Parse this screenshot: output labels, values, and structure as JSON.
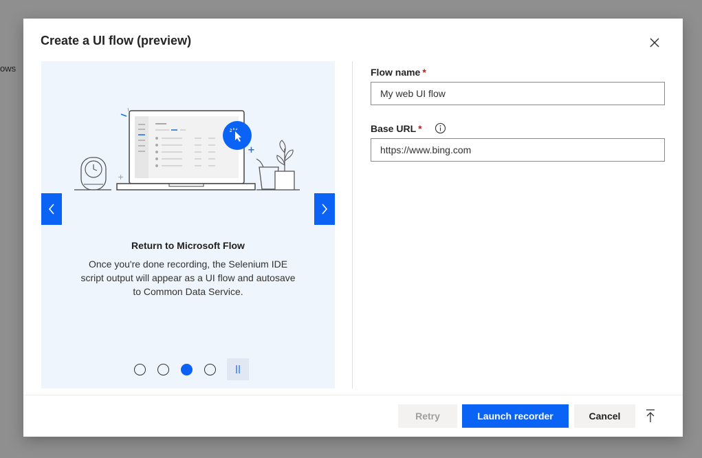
{
  "background": {
    "partial_text": "ows"
  },
  "dialog": {
    "title": "Create a UI flow (preview)",
    "close_icon": "close-icon"
  },
  "carousel": {
    "slide_title": "Return to Microsoft Flow",
    "slide_description": "Once you're done recording, the Selenium IDE script output will appear as a UI flow and autosave to Common Data Service.",
    "total_slides": 4,
    "active_slide": 3,
    "prev_icon": "chevron-left-icon",
    "next_icon": "chevron-right-icon",
    "pause_icon": "pause-icon"
  },
  "form": {
    "flow_name": {
      "label": "Flow name",
      "required_marker": "*",
      "value": "My web UI flow"
    },
    "base_url": {
      "label": "Base URL",
      "required_marker": "*",
      "value": "https://www.bing.com",
      "info_icon": "info-icon"
    }
  },
  "footer": {
    "retry_label": "Retry",
    "launch_label": "Launch recorder",
    "cancel_label": "Cancel",
    "scroll_top_icon": "scroll-to-top-icon"
  },
  "colors": {
    "accent": "#0b63f6",
    "carousel_bg": "#eff5fd",
    "required": "#a4262c"
  }
}
